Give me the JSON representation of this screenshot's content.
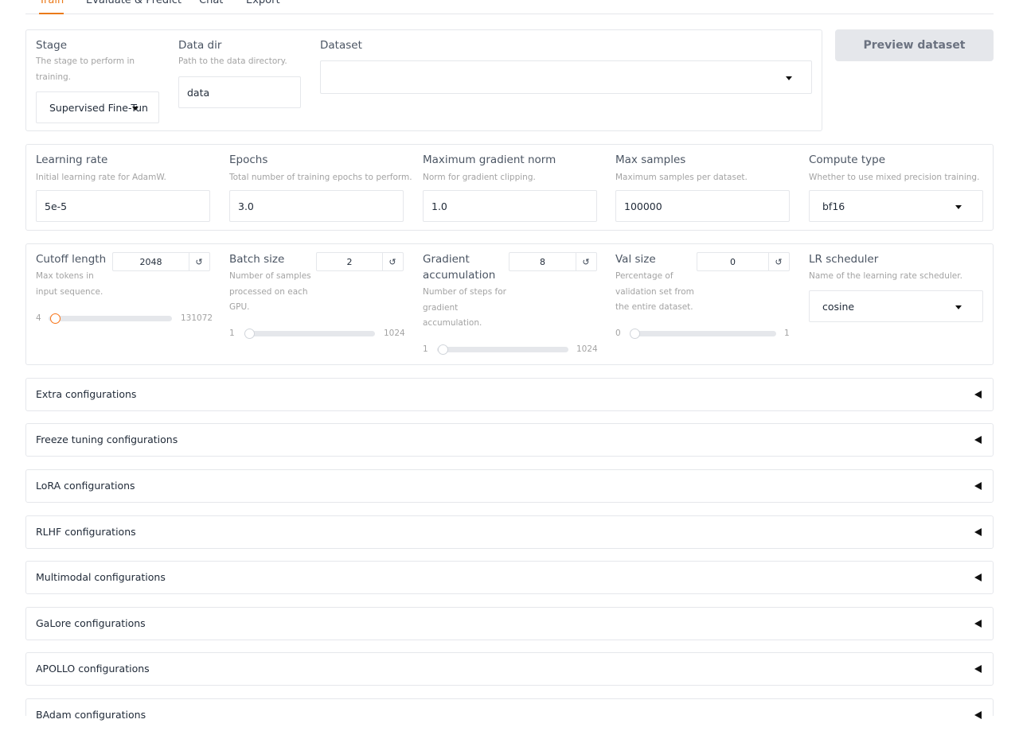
{
  "tabs": [
    "Train",
    "Evaluate & Predict",
    "Chat",
    "Export"
  ],
  "stage": {
    "label": "Stage",
    "info": [
      "The stage to perform in",
      "training."
    ],
    "value": "Supervised Fine-Tun"
  },
  "data_dir": {
    "label": "Data dir",
    "info": "Path to the data directory.",
    "value": "data"
  },
  "dataset": {
    "label": "Dataset",
    "value": ""
  },
  "preview_button": "Preview dataset",
  "learning_rate": {
    "label": "Learning rate",
    "info": "Initial learning rate for AdamW.",
    "value": "5e-5"
  },
  "epochs": {
    "label": "Epochs",
    "info": "Total number of training epochs to perform.",
    "value": "3.0"
  },
  "max_grad_norm": {
    "label": "Maximum gradient norm",
    "info": "Norm for gradient clipping.",
    "value": "1.0"
  },
  "max_samples": {
    "label": "Max samples",
    "info": "Maximum samples per dataset.",
    "value": "100000"
  },
  "compute_type": {
    "label": "Compute type",
    "info": "Whether to use mixed precision training.",
    "value": "bf16"
  },
  "cutoff_len": {
    "label": "Cutoff length",
    "info": [
      "Max tokens in",
      "input sequence."
    ],
    "value": "2048",
    "min": "4",
    "max": "131072",
    "fraction": 0.015
  },
  "batch_size": {
    "label": "Batch size",
    "info": [
      "Number of samples",
      "processed on each",
      "GPU."
    ],
    "value": "2",
    "min": "1",
    "max": "1024",
    "fraction": 0.001
  },
  "grad_accum": {
    "label": [
      "Gradient",
      "accumulation"
    ],
    "info": [
      "Number of steps for",
      "gradient",
      "accumulation."
    ],
    "value": "8",
    "min": "1",
    "max": "1024",
    "fraction": 0.007
  },
  "val_size": {
    "label": "Val size",
    "info": [
      "Percentage of",
      "validation set from",
      "the entire dataset."
    ],
    "value": "0",
    "min": "0",
    "max": "1",
    "fraction": 0.0
  },
  "lr_scheduler": {
    "label": "LR scheduler",
    "info": "Name of the learning rate scheduler.",
    "value": "cosine"
  },
  "reset_icon": "↺",
  "accordions": [
    "Extra configurations",
    "Freeze tuning configurations",
    "LoRA configurations",
    "RLHF configurations",
    "Multimodal configurations",
    "GaLore configurations",
    "APOLLO configurations",
    "BAdam configurations"
  ],
  "colors": {
    "accent": "#ea7a1a",
    "border": "#e5e7eb",
    "muted": "#a3a3a3",
    "button_bg": "#e5e7eb"
  }
}
